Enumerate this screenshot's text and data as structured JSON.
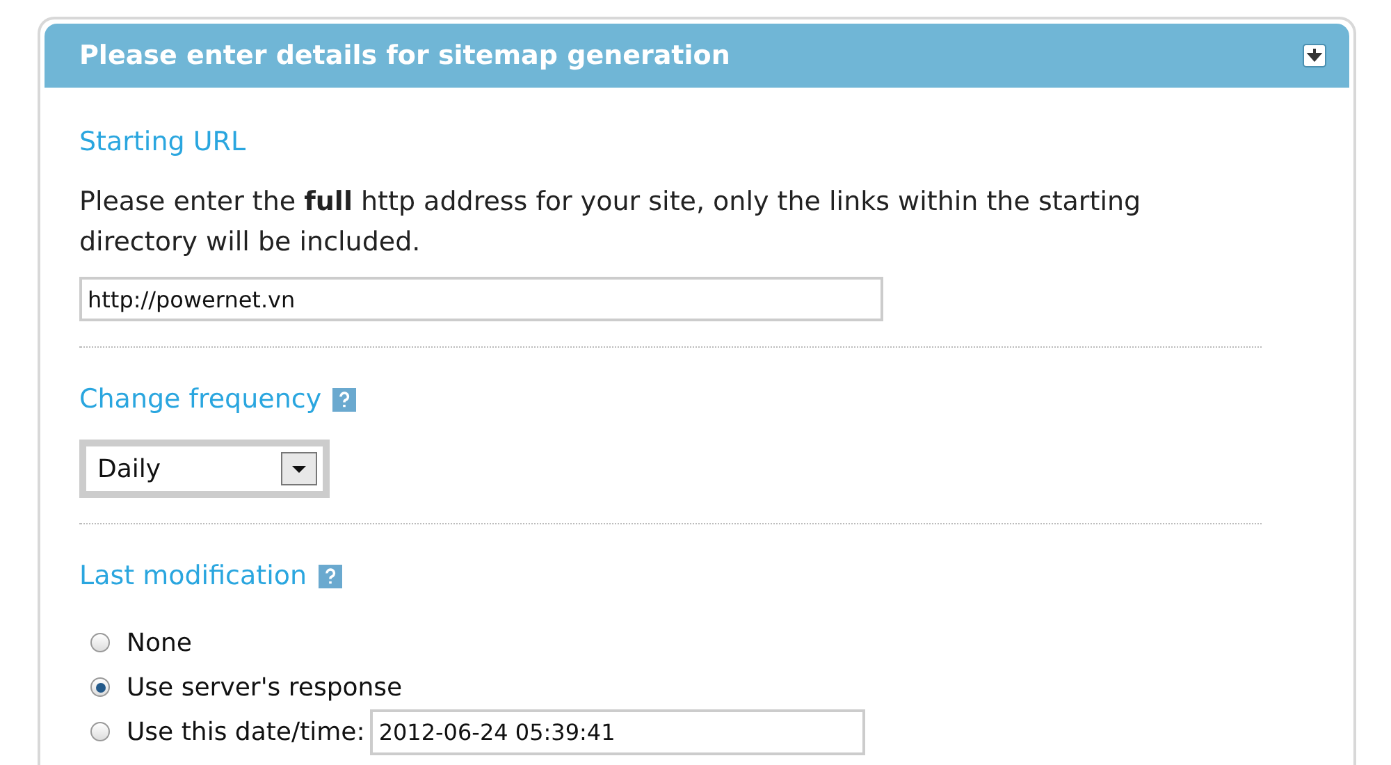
{
  "panel": {
    "title": "Please enter details for sitemap generation"
  },
  "sections": [
    {
      "kind": "url",
      "heading": "Starting URL",
      "help": false,
      "description": "Please enter the **full** http address for your site, only the links within the starting directory will be included.",
      "value": "http://powernet.vn"
    },
    {
      "kind": "select",
      "heading": "Change frequency",
      "help": true,
      "value": "Daily"
    },
    {
      "kind": "radios",
      "heading": "Last modification",
      "help": true,
      "options": [
        {
          "label": "None",
          "selected": false
        },
        {
          "label": "Use server's response",
          "selected": true
        },
        {
          "label": "Use this date/time:",
          "selected": false,
          "value": "2012-06-24 05:39:41"
        }
      ]
    }
  ]
}
